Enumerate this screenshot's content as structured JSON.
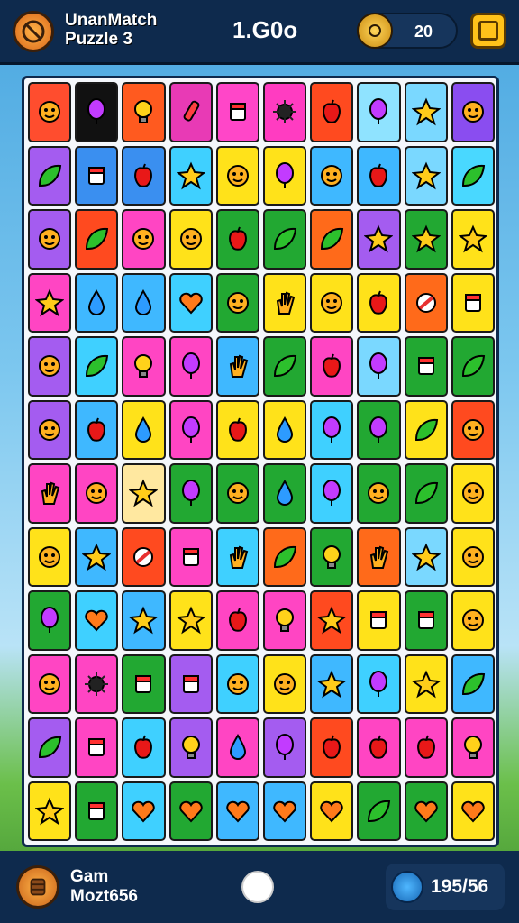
{
  "header": {
    "title_line1": "UnanMatch",
    "title_line2": "Puzzle 3",
    "score": "1.G0o",
    "coins": "20",
    "logo_icon": "no-symbol-icon",
    "coin_icon": "coin-icon",
    "menu_icon": "square-menu-icon"
  },
  "footer": {
    "label_line1": "Gam",
    "label_line2": "Mozt656",
    "moves": "195/56",
    "badge_icon": "barrel-icon",
    "moves_icon": "clock-icon"
  },
  "board": {
    "columns": 10,
    "rows": [
      [
        [
          "#ff4d2e",
          "face"
        ],
        [
          "#111111",
          "balloon"
        ],
        [
          "#ff5a1f",
          "bulb"
        ],
        [
          "#e83ab5",
          "rocket"
        ],
        [
          "#ff46c8",
          "box"
        ],
        [
          "#ff3cc1",
          "urchin"
        ],
        [
          "#ff4a1f",
          "apple"
        ],
        [
          "#8fe3ff",
          "balloon"
        ],
        [
          "#7ad8ff",
          "star"
        ],
        [
          "#8a4df0",
          "face"
        ]
      ],
      [
        [
          "#a45cf0",
          "leaf"
        ],
        [
          "#3a8ff0",
          "box"
        ],
        [
          "#3a8ff0",
          "apple"
        ],
        [
          "#3fd0ff",
          "star"
        ],
        [
          "#ffe21a",
          "face"
        ],
        [
          "#ffe21a",
          "balloon"
        ],
        [
          "#3fb8ff",
          "face"
        ],
        [
          "#3fb8ff",
          "apple"
        ],
        [
          "#7ad8ff",
          "star"
        ],
        [
          "#49d8ff",
          "leaf"
        ]
      ],
      [
        [
          "#a45cf0",
          "face"
        ],
        [
          "#ff4a1f",
          "leaf"
        ],
        [
          "#ff45c3",
          "face"
        ],
        [
          "#ffe21a",
          "face"
        ],
        [
          "#22a832",
          "apple"
        ],
        [
          "#22a832",
          "leaf"
        ],
        [
          "#ff6a1a",
          "leaf"
        ],
        [
          "#a45cf0",
          "star"
        ],
        [
          "#22a832",
          "star"
        ],
        [
          "#ffe21a",
          "star"
        ]
      ],
      [
        [
          "#ff45c3",
          "star"
        ],
        [
          "#3fb8ff",
          "drop"
        ],
        [
          "#3fb8ff",
          "drop"
        ],
        [
          "#3fd0ff",
          "heart"
        ],
        [
          "#22a832",
          "face"
        ],
        [
          "#ffe21a",
          "hand"
        ],
        [
          "#ffe21a",
          "face"
        ],
        [
          "#ffe21a",
          "apple"
        ],
        [
          "#ff6a1a",
          "ring"
        ],
        [
          "#ffe21a",
          "box"
        ]
      ],
      [
        [
          "#a45cf0",
          "face"
        ],
        [
          "#3fd0ff",
          "leaf"
        ],
        [
          "#ff45c3",
          "bulb"
        ],
        [
          "#ff45c3",
          "balloon"
        ],
        [
          "#3fb8ff",
          "hand"
        ],
        [
          "#22a832",
          "leaf"
        ],
        [
          "#ff45c3",
          "apple"
        ],
        [
          "#7ad8ff",
          "balloon"
        ],
        [
          "#22a832",
          "box"
        ],
        [
          "#22a832",
          "leaf"
        ]
      ],
      [
        [
          "#a45cf0",
          "face"
        ],
        [
          "#3fb8ff",
          "apple"
        ],
        [
          "#ffe21a",
          "drop"
        ],
        [
          "#ff45c3",
          "balloon"
        ],
        [
          "#ffe21a",
          "apple"
        ],
        [
          "#ffe21a",
          "drop"
        ],
        [
          "#3fd0ff",
          "balloon"
        ],
        [
          "#22a832",
          "balloon"
        ],
        [
          "#ffe21a",
          "leaf"
        ],
        [
          "#ff4a1f",
          "face"
        ]
      ],
      [
        [
          "#ff45c3",
          "hand"
        ],
        [
          "#ff45c3",
          "face"
        ],
        [
          "#ffe8a0",
          "star"
        ],
        [
          "#22a832",
          "balloon"
        ],
        [
          "#22a832",
          "face"
        ],
        [
          "#22a832",
          "drop"
        ],
        [
          "#3fd0ff",
          "balloon"
        ],
        [
          "#22a832",
          "face"
        ],
        [
          "#22a832",
          "leaf"
        ],
        [
          "#ffe21a",
          "face"
        ]
      ],
      [
        [
          "#ffe21a",
          "face"
        ],
        [
          "#3fb8ff",
          "star"
        ],
        [
          "#ff4a1f",
          "ring"
        ],
        [
          "#ff45c3",
          "box"
        ],
        [
          "#3fd0ff",
          "hand"
        ],
        [
          "#ff6a1a",
          "leaf"
        ],
        [
          "#22a832",
          "bulb"
        ],
        [
          "#ff6a1a",
          "hand"
        ],
        [
          "#7ad8ff",
          "star"
        ],
        [
          "#ffe21a",
          "face"
        ]
      ],
      [
        [
          "#22a832",
          "balloon"
        ],
        [
          "#3fd0ff",
          "heart"
        ],
        [
          "#3fb8ff",
          "star"
        ],
        [
          "#ffe21a",
          "star"
        ],
        [
          "#ff45c3",
          "apple"
        ],
        [
          "#ff45c3",
          "bulb"
        ],
        [
          "#ff4a1f",
          "star"
        ],
        [
          "#ffe21a",
          "box"
        ],
        [
          "#22a832",
          "box"
        ],
        [
          "#ffe21a",
          "face"
        ]
      ],
      [
        [
          "#ff45c3",
          "face"
        ],
        [
          "#ff45c3",
          "urchin"
        ],
        [
          "#22a832",
          "box"
        ],
        [
          "#a45cf0",
          "box"
        ],
        [
          "#3fd0ff",
          "face"
        ],
        [
          "#ffe21a",
          "face"
        ],
        [
          "#3fb8ff",
          "star"
        ],
        [
          "#3fd0ff",
          "balloon"
        ],
        [
          "#ffe21a",
          "star"
        ],
        [
          "#3fb8ff",
          "leaf"
        ]
      ],
      [
        [
          "#a45cf0",
          "leaf"
        ],
        [
          "#ff45c3",
          "box"
        ],
        [
          "#3fd0ff",
          "apple"
        ],
        [
          "#a45cf0",
          "bulb"
        ],
        [
          "#ff45c3",
          "drop"
        ],
        [
          "#a45cf0",
          "balloon"
        ],
        [
          "#ff4a1f",
          "apple"
        ],
        [
          "#ff45c3",
          "apple"
        ],
        [
          "#ff45c3",
          "apple"
        ],
        [
          "#ff45c3",
          "bulb"
        ]
      ],
      [
        [
          "#ffe21a",
          "star"
        ],
        [
          "#22a832",
          "box"
        ],
        [
          "#3fd0ff",
          "heart"
        ],
        [
          "#22a832",
          "heart"
        ],
        [
          "#3fb8ff",
          "heart"
        ],
        [
          "#3fb8ff",
          "heart"
        ],
        [
          "#ffe21a",
          "heart"
        ],
        [
          "#22a832",
          "leaf"
        ],
        [
          "#22a832",
          "heart"
        ],
        [
          "#ffe21a",
          "heart"
        ]
      ]
    ]
  }
}
